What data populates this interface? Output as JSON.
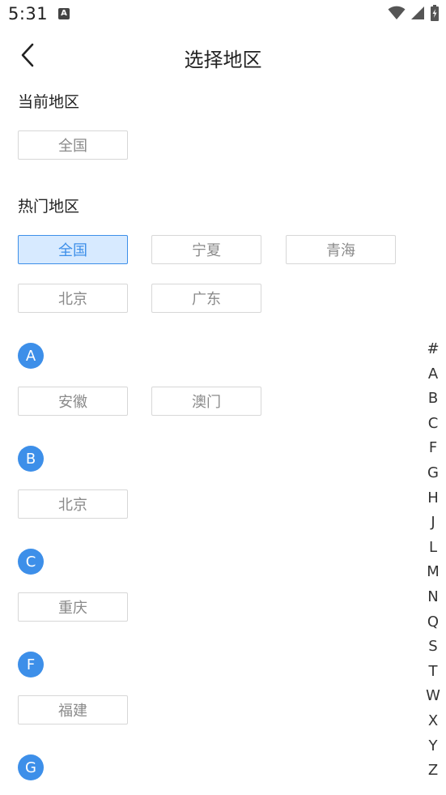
{
  "status_bar": {
    "time": "5:31",
    "notif_glyph": "A"
  },
  "nav": {
    "title": "选择地区"
  },
  "current_region": {
    "label": "当前地区",
    "chip": "全国"
  },
  "hot_regions": {
    "label": "热门地区",
    "chips": [
      "全国",
      "宁夏",
      "青海",
      "北京",
      "广东"
    ],
    "selected": "全国"
  },
  "groups": [
    {
      "letter": "A",
      "items": [
        "安徽",
        "澳门"
      ]
    },
    {
      "letter": "B",
      "items": [
        "北京"
      ]
    },
    {
      "letter": "C",
      "items": [
        "重庆"
      ]
    },
    {
      "letter": "F",
      "items": [
        "福建"
      ]
    },
    {
      "letter": "G",
      "items": []
    }
  ],
  "index_letters": [
    "#",
    "A",
    "B",
    "C",
    "F",
    "G",
    "H",
    "J",
    "L",
    "M",
    "N",
    "Q",
    "S",
    "T",
    "W",
    "X",
    "Y",
    "Z"
  ],
  "colors": {
    "accent": "#3d8fe9",
    "chip_selected_bg": "#d7eaff",
    "chip_border": "#d7d7d7",
    "chip_text": "#8a8a8a"
  },
  "icons": {
    "back": "chevron-left-icon",
    "wifi": "wifi-icon",
    "signal": "signal-icon",
    "battery": "battery-icon",
    "notification": "notification-icon"
  }
}
